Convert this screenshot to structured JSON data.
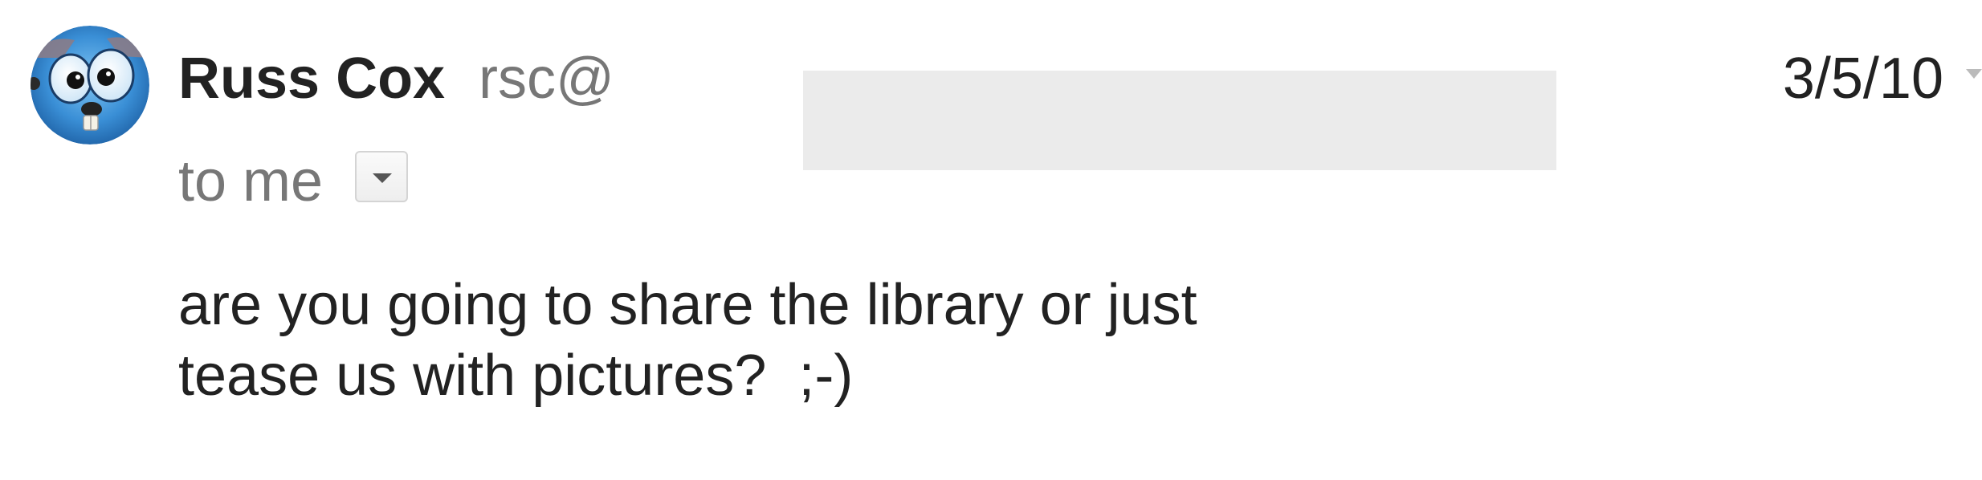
{
  "message": {
    "sender": {
      "avatar_icon": "gopher-avatar-icon",
      "name": "Russ Cox",
      "email_visible": "rsc@",
      "email_redacted": true
    },
    "date": "3/5/10",
    "recipient": {
      "label": "to me",
      "details_toggle_icon": "chevron-down-icon"
    },
    "body_lines": [
      "are you going to share the library or just",
      "tease us with pictures?  ;-)"
    ]
  },
  "colors": {
    "name": "#222222",
    "email": "#777777",
    "redaction": "#ebebeb",
    "body": "#222222",
    "avatar_blue": "#3a8fd6"
  }
}
